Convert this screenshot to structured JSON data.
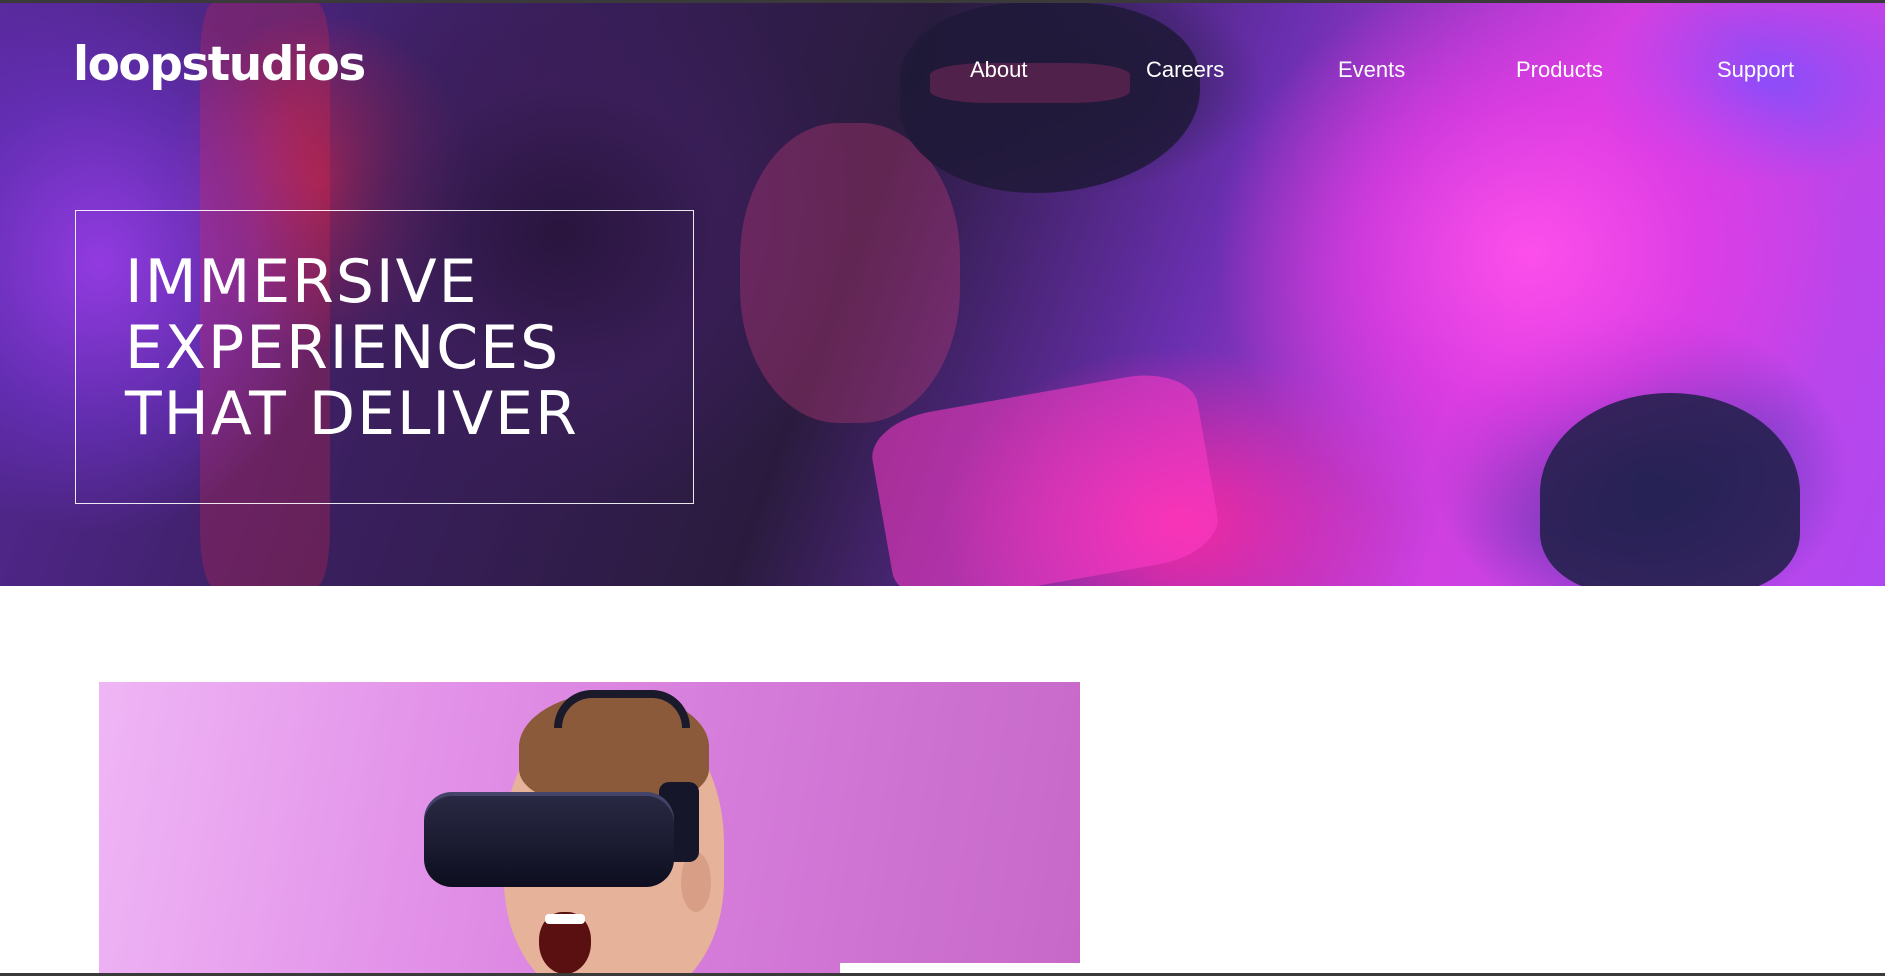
{
  "header": {
    "logo": "loopstudios",
    "nav": [
      {
        "label": "About"
      },
      {
        "label": "Careers"
      },
      {
        "label": "Events"
      },
      {
        "label": "Products"
      },
      {
        "label": "Support"
      }
    ]
  },
  "hero": {
    "title_lines": [
      "IMMERSIVE",
      "EXPERIENCES",
      "THAT DELIVER"
    ]
  },
  "colors": {
    "text_on_hero": "#ffffff",
    "page_background": "#ffffff",
    "hero_accent_magenta": "#d040e0",
    "hero_accent_purple": "#5a2aa0",
    "content_image_pink": "#e291e8"
  },
  "images": {
    "hero_background": "person-wearing-vr-headset-neon-lit",
    "content_image": "man-wearing-vr-headset-shouting"
  }
}
